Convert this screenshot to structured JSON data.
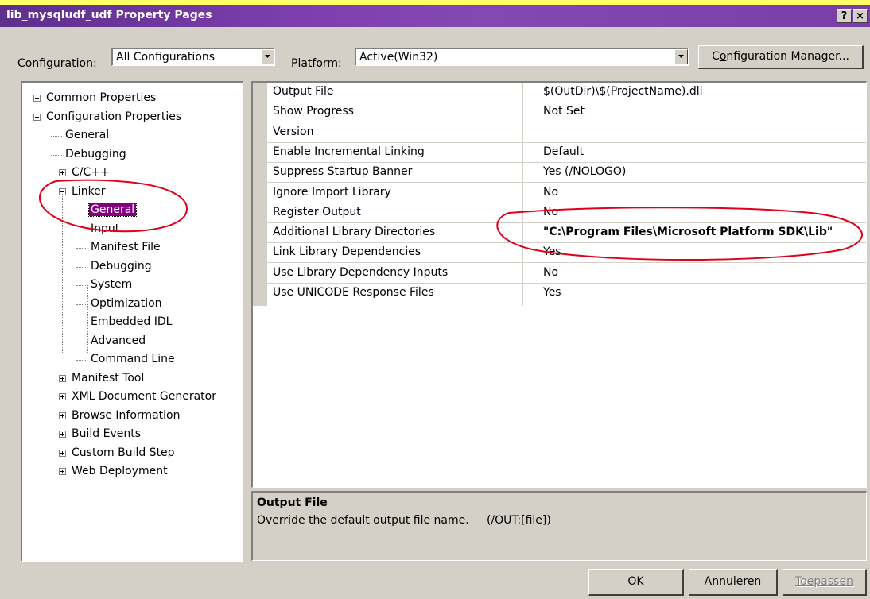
{
  "window": {
    "title": "lib_mysqludf_udf Property Pages",
    "help_btn": "?",
    "close_btn": "×"
  },
  "config": {
    "label": "Configuration:",
    "value": "All Configurations"
  },
  "platform": {
    "label": "Platform:",
    "value": "Active(Win32)"
  },
  "config_manager_button": "Configuration Manager...",
  "tree": {
    "items": [
      {
        "label": "Common Properties",
        "expander": "plus",
        "level": 0
      },
      {
        "label": "Configuration Properties",
        "expander": "minus",
        "level": 0
      },
      {
        "label": "General",
        "level": 1
      },
      {
        "label": "Debugging",
        "level": 1
      },
      {
        "label": "C/C++",
        "expander": "plus",
        "level": 1
      },
      {
        "label": "Linker",
        "expander": "minus",
        "level": 1
      },
      {
        "label": "General",
        "level": 2,
        "selected": true
      },
      {
        "label": "Input",
        "level": 2
      },
      {
        "label": "Manifest File",
        "level": 2
      },
      {
        "label": "Debugging",
        "level": 2
      },
      {
        "label": "System",
        "level": 2
      },
      {
        "label": "Optimization",
        "level": 2
      },
      {
        "label": "Embedded IDL",
        "level": 2
      },
      {
        "label": "Advanced",
        "level": 2
      },
      {
        "label": "Command Line",
        "level": 2
      },
      {
        "label": "Manifest Tool",
        "expander": "plus",
        "level": 1
      },
      {
        "label": "XML Document Generator",
        "expander": "plus",
        "level": 1
      },
      {
        "label": "Browse Information",
        "expander": "plus",
        "level": 1
      },
      {
        "label": "Build Events",
        "expander": "plus",
        "level": 1
      },
      {
        "label": "Custom Build Step",
        "expander": "plus",
        "level": 1
      },
      {
        "label": "Web Deployment",
        "expander": "plus",
        "level": 1
      }
    ]
  },
  "properties": [
    {
      "name": "Output File",
      "value": "$(OutDir)\\$(ProjectName).dll"
    },
    {
      "name": "Show Progress",
      "value": "Not Set"
    },
    {
      "name": "Version",
      "value": ""
    },
    {
      "name": "Enable Incremental Linking",
      "value": "Default"
    },
    {
      "name": "Suppress Startup Banner",
      "value": "Yes (/NOLOGO)"
    },
    {
      "name": "Ignore Import Library",
      "value": "No"
    },
    {
      "name": "Register Output",
      "value": "No"
    },
    {
      "name": "Additional Library Directories",
      "value": "\"C:\\Program Files\\Microsoft Platform SDK\\Lib\"",
      "bold": true
    },
    {
      "name": "Link Library Dependencies",
      "value": "Yes"
    },
    {
      "name": "Use Library Dependency Inputs",
      "value": "No"
    },
    {
      "name": "Use UNICODE Response Files",
      "value": "Yes"
    }
  ],
  "description": {
    "title": "Output File",
    "text": "Override the default output file name.     (/OUT:[file])"
  },
  "buttons": {
    "ok": "OK",
    "cancel": "Annuleren",
    "apply": "Toepassen"
  },
  "colors": {
    "selection": "#800080",
    "annotation": "#e0001a",
    "title_gradient": "#6a3a9e"
  }
}
